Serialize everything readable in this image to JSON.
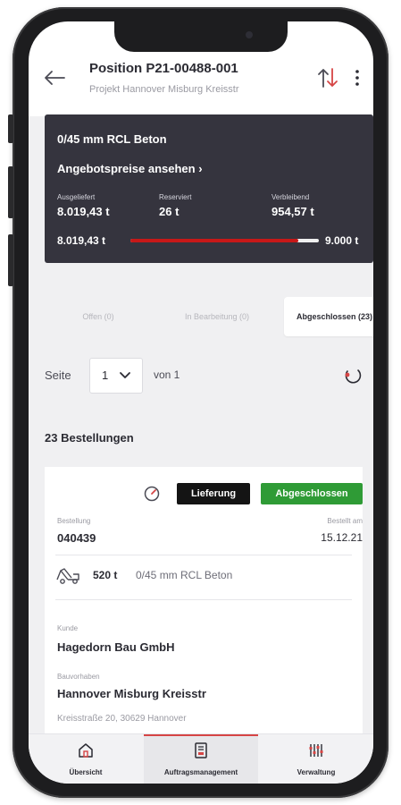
{
  "header": {
    "title": "Position P21-00488-001",
    "subtitle": "Projekt Hannover Misburg Kreisstr"
  },
  "summary": {
    "material": "0/45 mm RCL Beton",
    "offer_link": "Angebotspreise ansehen ›",
    "delivered_label": "Ausgeliefert",
    "delivered_value": "8.019,43 t",
    "reserved_label": "Reserviert",
    "reserved_value": "26 t",
    "remaining_label": "Verbleibend",
    "remaining_value": "954,57 t",
    "progress_left": "8.019,43 t",
    "progress_right": "9.000 t",
    "progress_fraction": 0.891,
    "progress_color": "#c71818"
  },
  "tabs": [
    {
      "label": "Offen (0)"
    },
    {
      "label": "In Bearbeitung (0)"
    },
    {
      "label": "Abgeschlossen (23)"
    }
  ],
  "pagination": {
    "page_label": "Seite",
    "current_page": "1",
    "of_label": "von 1"
  },
  "orders_count": "23 Bestellungen",
  "order": {
    "type_badge": "Lieferung",
    "status_badge": "Abgeschlossen",
    "status_color": "#2f9b36",
    "order_label": "Bestellung",
    "order_number": "040439",
    "ordered_label": "Bestellt am",
    "ordered_date": "15.12.21",
    "quantity": "520 t",
    "quantity_material": "0/45 mm RCL Beton",
    "customer_label": "Kunde",
    "customer": "Hagedorn Bau GmbH",
    "project_label": "Bauvorhaben",
    "project": "Hannover Misburg Kreisstr",
    "address": "Kreisstraße 20, 30629 Hannover"
  },
  "nav": [
    {
      "label": "Übersicht",
      "icon": "home-icon"
    },
    {
      "label": "Auftragsmanagement",
      "icon": "document-icon"
    },
    {
      "label": "Verwaltung",
      "icon": "sliders-icon"
    }
  ],
  "colors": {
    "accent": "#d64545",
    "dark_card": "#35343e"
  }
}
